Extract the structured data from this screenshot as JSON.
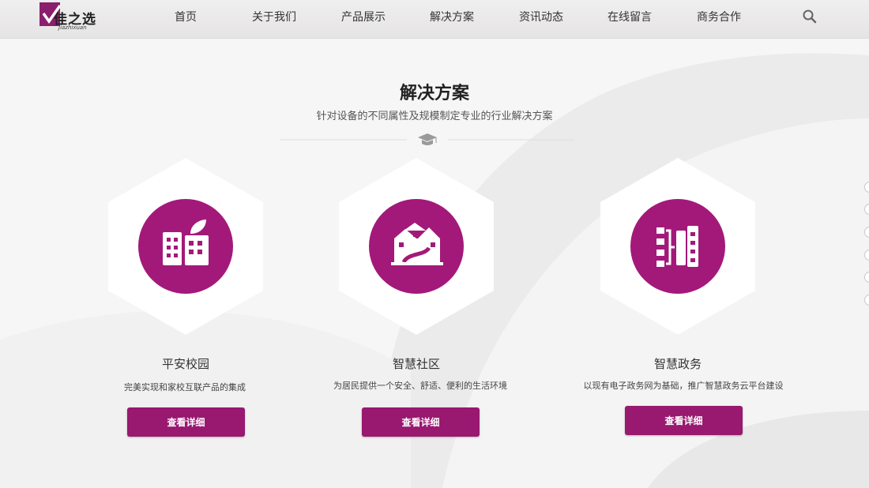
{
  "logo": {
    "name": "佳之选",
    "sub": "Jiazhixuan"
  },
  "nav": {
    "items": [
      "首页",
      "关于我们",
      "产品展示",
      "解决方案",
      "资讯动态",
      "在线留言",
      "商务合作"
    ],
    "search_icon": "search-icon"
  },
  "section": {
    "title": "解决方案",
    "subtitle": "针对设备的不同属性及规模制定专业的行业解决方案",
    "divider_icon": "graduation-cap-icon"
  },
  "cards": [
    {
      "title": "平安校园",
      "desc": "完美实现和家校互联产品的集成",
      "button": "查看详细",
      "icon": "campus-buildings-icon"
    },
    {
      "title": "智慧社区",
      "desc": "为居民提供一个安全、舒适、便利的生活环境",
      "button": "查看详细",
      "icon": "community-houses-icon"
    },
    {
      "title": "智慧政务",
      "desc": "以现有电子政务网为基础，推广智慧政务云平台建设",
      "button": "查看详细",
      "icon": "government-network-icon"
    }
  ],
  "colors": {
    "accent": "#a3197a",
    "button": "#98196f",
    "brand": "#8b1f6e"
  },
  "side_dots": 6
}
